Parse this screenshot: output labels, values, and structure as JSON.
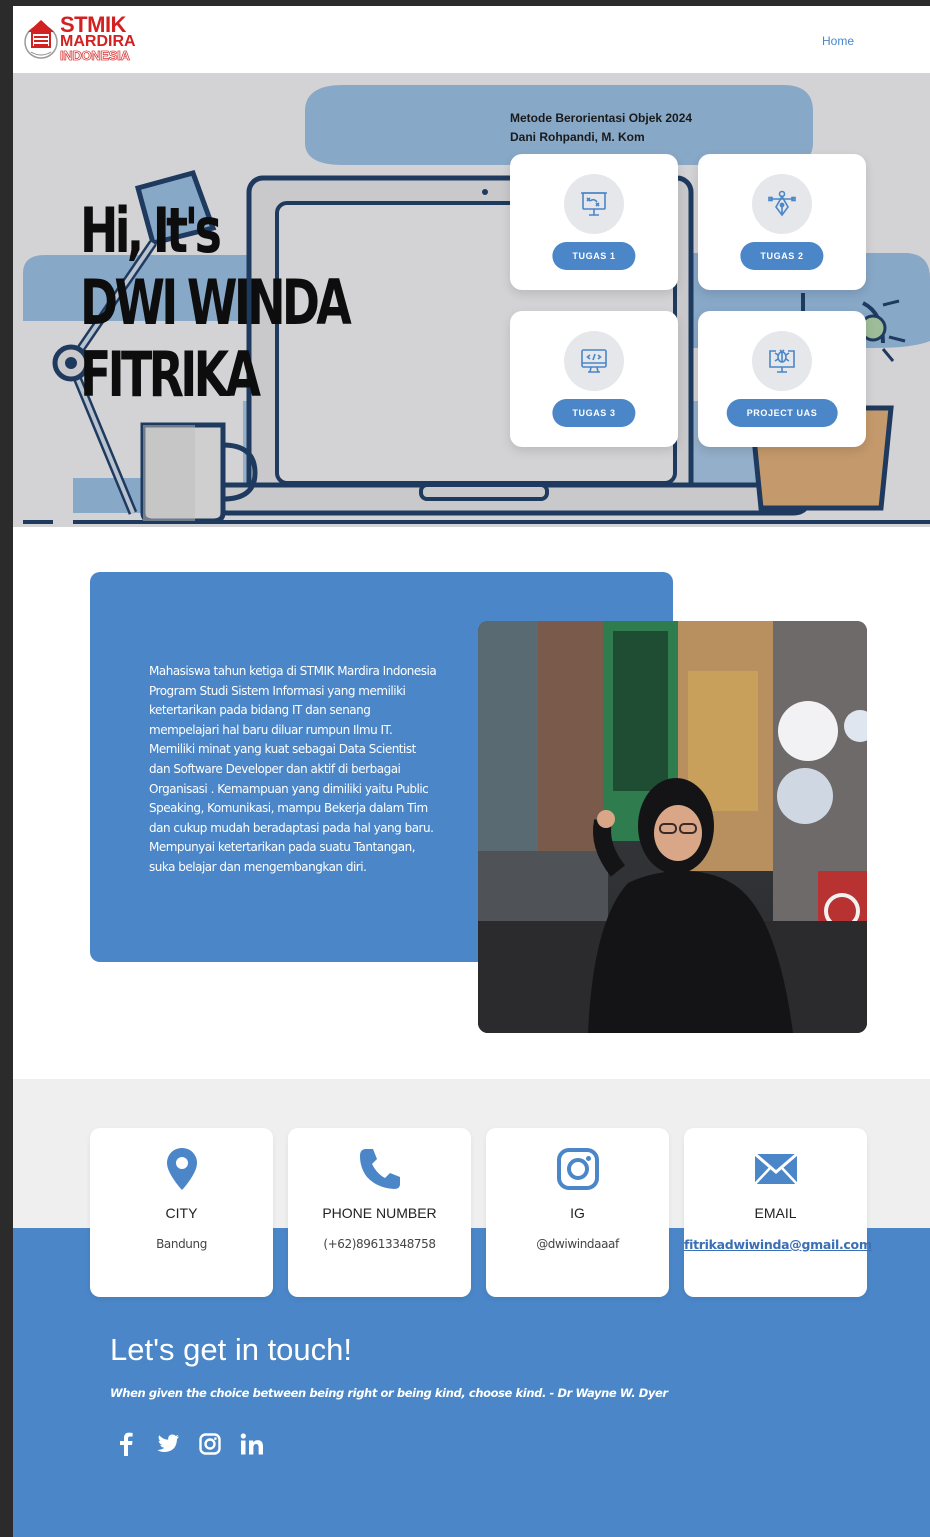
{
  "navbar": {
    "logo": {
      "line1": "STMIK",
      "line2": "MARDIRA",
      "line3": "INDONESIA"
    },
    "links": [
      {
        "label": "Home"
      }
    ]
  },
  "hero": {
    "title_lines": [
      "Hi, It's",
      "DWI WINDA",
      "FITRIKA"
    ],
    "course": "Metode Berorientasi Objek 2024",
    "lecturer": "Dani Rohpandi, M. Kom",
    "cards": [
      {
        "label": "TUGAS 1",
        "icon": "presentation-board-icon"
      },
      {
        "label": "TUGAS 2",
        "icon": "pen-tool-icon"
      },
      {
        "label": "TUGAS 3",
        "icon": "code-monitor-icon"
      },
      {
        "label": "PROJECT UAS",
        "icon": "bug-monitor-icon"
      }
    ]
  },
  "about": {
    "text": "Mahasiswa tahun ketiga di STMIK Mardira Indonesia Program Studi Sistem Informasi yang memiliki ketertarikan pada bidang IT dan senang mempelajari hal baru diluar rumpun Ilmu IT. Memiliki minat yang kuat sebagai Data Scientist dan Software Developer dan aktif di berbagai Organisasi . Kemampuan yang dimiliki yaitu Public Speaking, Komunikasi, mampu Bekerja dalam Tim dan cukup mudah beradaptasi pada hal yang baru. Mempunyai ketertarikan pada suatu Tantangan, suka belajar dan mengembangkan diri."
  },
  "contact": {
    "cards": [
      {
        "title": "CITY",
        "value": "Bandung",
        "icon": "location-pin-icon"
      },
      {
        "title": "PHONE NUMBER",
        "value": "(+62)89613348758",
        "icon": "phone-icon"
      },
      {
        "title": "IG",
        "value": "@dwiwindaaaf",
        "icon": "instagram-icon"
      },
      {
        "title": "EMAIL",
        "value": "fitrikadwiwinda@gmail.com",
        "icon": "envelope-icon"
      }
    ],
    "heading": "Let's get in touch!",
    "quote": "When given the choice between being right or being kind, choose kind. - Dr Wayne W. Dyer",
    "socials": [
      "facebook-icon",
      "twitter-icon",
      "instagram-icon",
      "linkedin-icon"
    ]
  },
  "colors": {
    "accent": "#4a86c8",
    "hero_bg": "#d3d3d5",
    "brand_red": "#d32020"
  }
}
